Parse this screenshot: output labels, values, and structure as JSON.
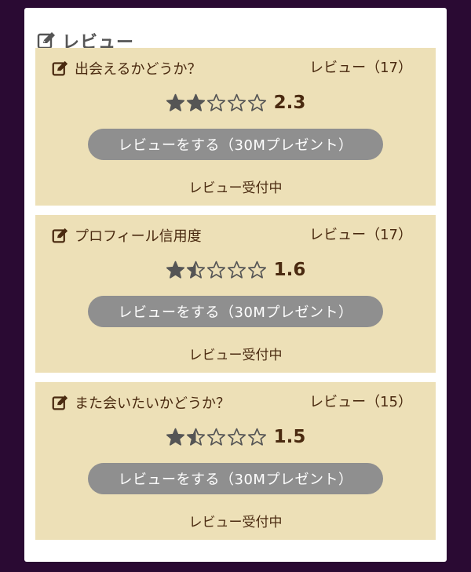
{
  "panel": {
    "title": "レビュー",
    "icon": "edit-icon"
  },
  "colors": {
    "background": "#2a0a33",
    "card": "#ede0b7",
    "button": "#8f8f8f",
    "text": "#4a2a10",
    "star_filled": "#555555"
  },
  "cards": [
    {
      "title": "出会えるかどうか？",
      "count_label": "レビュー（17）",
      "score": "2.3",
      "rating": 2.0,
      "button_label": "レビューをする（30Mプレゼント）",
      "status": "レビュー受付中"
    },
    {
      "title": "プロフィール信用度",
      "count_label": "レビュー（17）",
      "score": "1.6",
      "rating": 1.5,
      "button_label": "レビューをする（30Mプレゼント）",
      "status": "レビュー受付中"
    },
    {
      "title": "また会いたいかどうか？",
      "count_label": "レビュー（15）",
      "score": "1.5",
      "rating": 1.5,
      "button_label": "レビューをする（30Mプレゼント）",
      "status": "レビュー受付中"
    }
  ]
}
